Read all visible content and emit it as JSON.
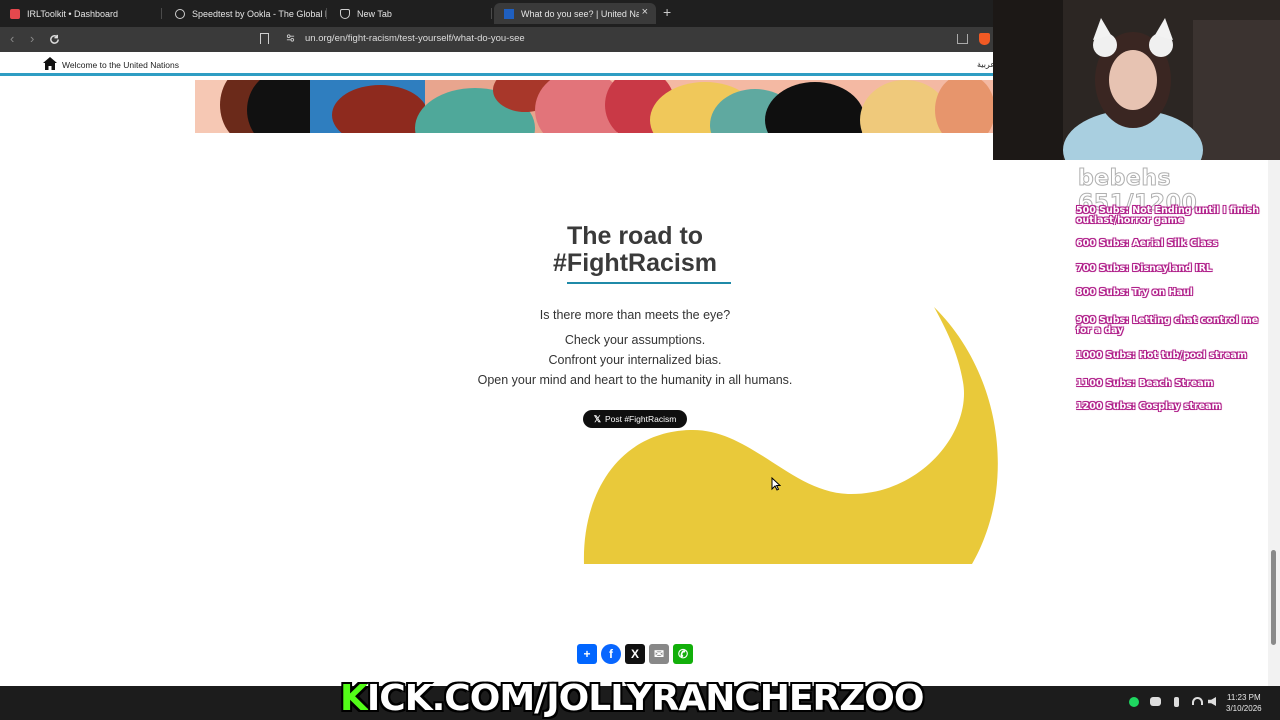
{
  "browser": {
    "tabs": [
      {
        "label": "IRLToolkit • Dashboard",
        "icon": "irltoolkit-icon",
        "color": "#e5484d"
      },
      {
        "label": "Speedtest by Ookla - The Global Broa",
        "icon": "speedtest-icon",
        "color": "#cfcfcf"
      },
      {
        "label": "New Tab",
        "icon": "brave-shield-icon",
        "color": "#cfcfcf"
      },
      {
        "label": "What do you see? | United Natio",
        "icon": "un-icon",
        "color": "#1f5fbf",
        "active": true
      }
    ],
    "url": "un.org/en/fight-racism/test-yourself/what-do-you-see"
  },
  "un_bar": {
    "welcome": "Welcome to the United Nations",
    "language": "عربية"
  },
  "content": {
    "heading": [
      "The road to",
      "#FightRacism"
    ],
    "question": "Is there more than meets the eye?",
    "lines": [
      "Check your assumptions.",
      "Confront your internalized bias.",
      "Open your mind and heart to the humanity in all humans."
    ],
    "post_button": "Post #FightRacism",
    "accent_color": "#e9c93a"
  },
  "share": [
    {
      "name": "share-add-button",
      "label": "+",
      "color": "#0166ff"
    },
    {
      "name": "share-facebook-button",
      "label": "f",
      "color": "#0866ff"
    },
    {
      "name": "share-x-button",
      "label": "X",
      "color": "#111111"
    },
    {
      "name": "share-email-button",
      "label": "✉",
      "color": "#888888"
    },
    {
      "name": "share-whatsapp-button",
      "label": "✆",
      "color": "#12af0a"
    }
  ],
  "overlay": {
    "goal_title": "bebehs 651/1200",
    "goals": [
      "500 Subs: Not Ending until I finish outlast/horror game",
      "600 Subs: Aerial Silk Class",
      "700 Subs: Disneyland IRL",
      "800 Subs: Try on Haul",
      "900 Subs: Letting chat control me for a day",
      "1000 Subs: Hot tub/pool stream",
      "1100 Subs: Beach Stream",
      "1200 Subs: Cosplay stream"
    ],
    "kick_prefix": "K",
    "kick_rest": "ICK.COM/JOLLYRANCHERZOO"
  },
  "taskbar": {
    "time": "11:23 PM",
    "date": "3/10/2026"
  }
}
